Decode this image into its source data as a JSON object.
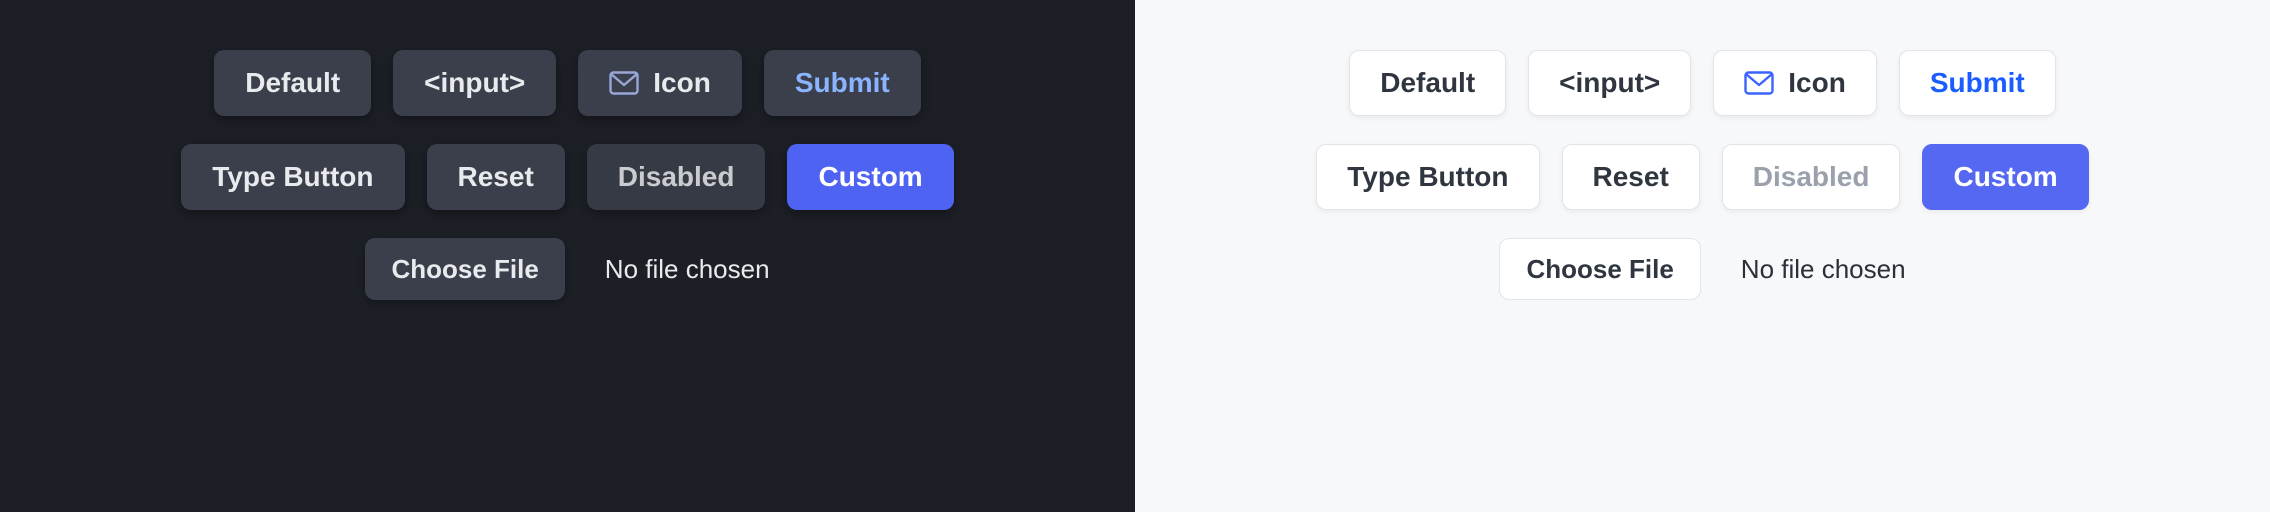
{
  "buttons": {
    "default": "Default",
    "input": "<input>",
    "icon": "Icon",
    "submit": "Submit",
    "type_button": "Type Button",
    "reset": "Reset",
    "disabled": "Disabled",
    "custom": "Custom"
  },
  "file": {
    "choose": "Choose File",
    "status": "No file chosen"
  },
  "colors": {
    "dark_bg": "#1c1f26",
    "dark_button_bg": "#3a3f4b",
    "light_bg": "#f7f8fa",
    "light_button_bg": "#ffffff",
    "accent": "#5468f2",
    "submit_text_dark": "#8ab4ff",
    "submit_text_light": "#1a5cff"
  }
}
